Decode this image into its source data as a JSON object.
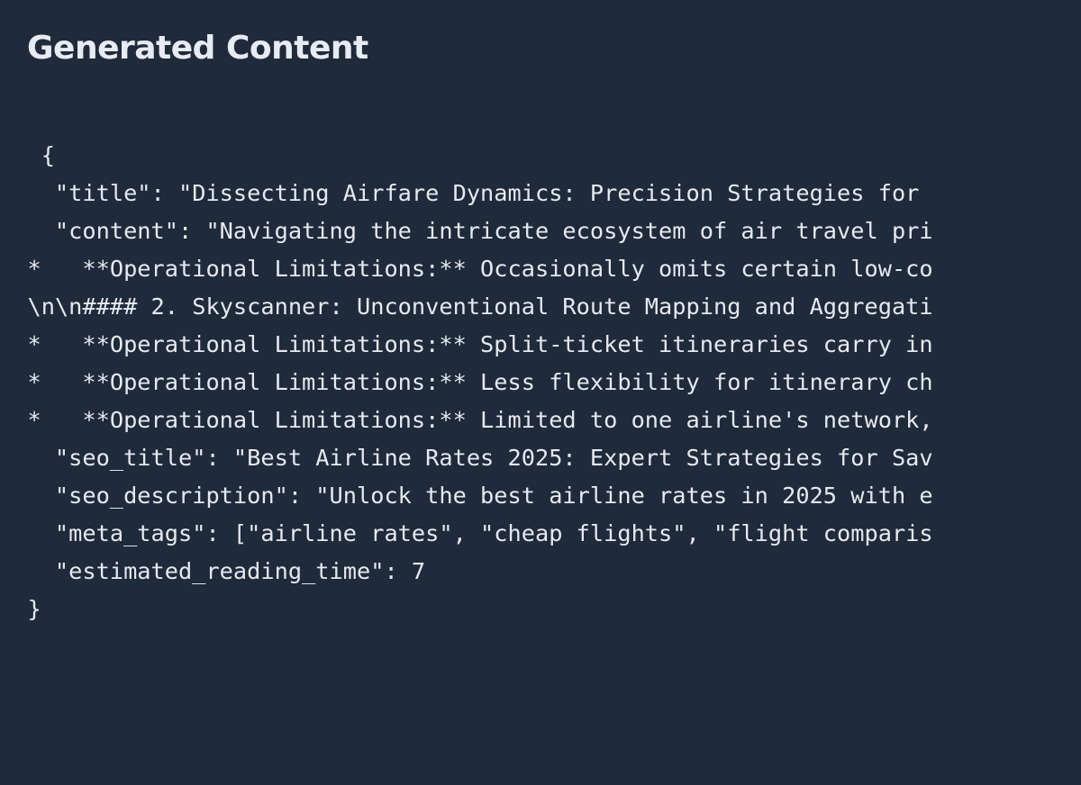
{
  "header": {
    "title": "Generated Content"
  },
  "code": {
    "lines": [
      "   {",
      "    \"title\": \"Dissecting Airfare Dynamics: Precision Strategies for ",
      "    \"content\": \"Navigating the intricate ecosystem of air travel pri",
      "  *   **Operational Limitations:** Occasionally omits certain low-co",
      "  \\n\\n#### 2. Skyscanner: Unconventional Route Mapping and Aggregati",
      "  *   **Operational Limitations:** Split-ticket itineraries carry in",
      "  *   **Operational Limitations:** Less flexibility for itinerary ch",
      "  *   **Operational Limitations:** Limited to one airline's network,",
      "    \"seo_title\": \"Best Airline Rates 2025: Expert Strategies for Sav",
      "    \"seo_description\": \"Unlock the best airline rates in 2025 with e",
      "    \"meta_tags\": [\"airline rates\", \"cheap flights\", \"flight comparis",
      "    \"estimated_reading_time\": 7",
      "  }"
    ]
  },
  "colors": {
    "background": "#1f2a3b",
    "text": "#e6e9ef"
  }
}
